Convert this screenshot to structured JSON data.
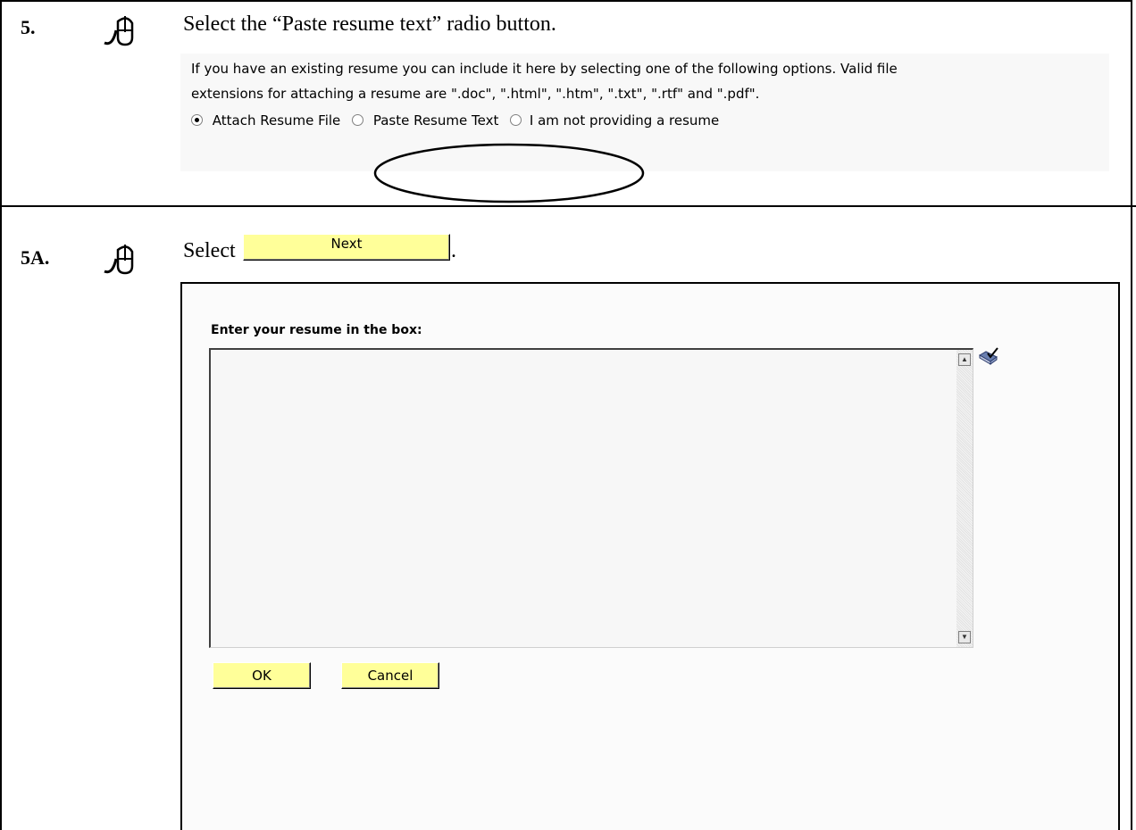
{
  "step5": {
    "number": "5.",
    "instruction": "Select the “Paste resume text” radio button.",
    "info_line1": "If you have an existing resume you can include it here by selecting one of the following options.  Valid file",
    "info_line2": "extensions for attaching a resume are \".doc\", \".html\", \".htm\", \".txt\", \".rtf\" and \".pdf\".",
    "options": [
      {
        "label": "Attach Resume File",
        "selected": true
      },
      {
        "label": "Paste Resume Text",
        "selected": false
      },
      {
        "label": "I am not providing a resume",
        "selected": false
      }
    ]
  },
  "step5a": {
    "number": "5A.",
    "instruction_prefix": "Select",
    "instruction_suffix": ".",
    "next_button": "Next",
    "heading": "Enter your resume in the box:",
    "ok_button": "OK",
    "cancel_button": "Cancel",
    "spellcheck_icon": "spell-check-icon"
  },
  "colors": {
    "button_bg": "#ffff99",
    "border": "#000000"
  }
}
